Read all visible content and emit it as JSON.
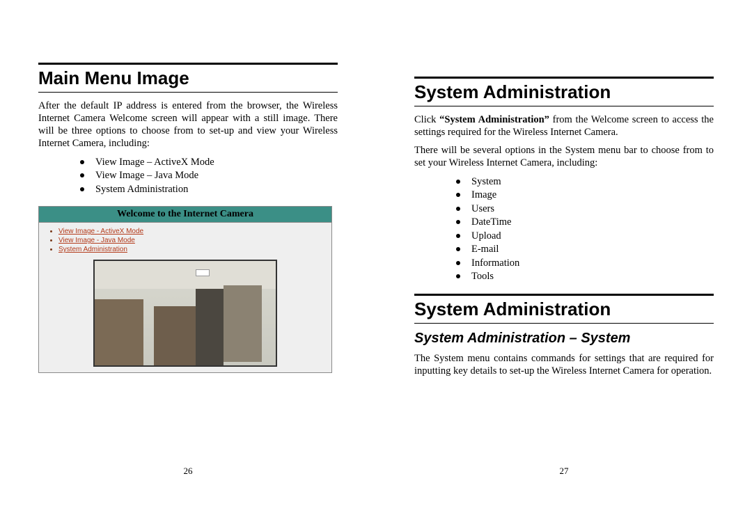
{
  "left": {
    "heading": "Main Menu Image",
    "para1": "After the default IP address is entered from the browser, the Wireless Internet Camera Welcome screen will appear with a still image.  There will be three options to choose from to set-up and view your Wireless Internet Camera, including:",
    "bullets": [
      "View Image – ActiveX Mode",
      "View Image – Java Mode",
      "System Administration"
    ],
    "screenshot": {
      "title": "Welcome to the Internet Camera",
      "links": [
        "View Image - ActiveX Mode",
        "View Image - Java Mode",
        "System Administration"
      ]
    },
    "page_number": "26"
  },
  "right": {
    "heading1": "System Administration",
    "para1": "Click “System Administration” from the Welcome screen to access the settings required for the Wireless Internet Camera.",
    "para2": "There will be several options in the System menu bar to choose from to set your Wireless Internet Camera, including:",
    "bullets": [
      "System",
      "Image",
      "Users",
      "DateTime",
      "Upload",
      "E-mail",
      "Information",
      "Tools"
    ],
    "heading2": "System Administration",
    "subheading": "System Administration – System",
    "para3": "The System menu contains commands for settings that are required for inputting key details to set-up the Wireless Internet Camera for operation.",
    "page_number": "27"
  }
}
